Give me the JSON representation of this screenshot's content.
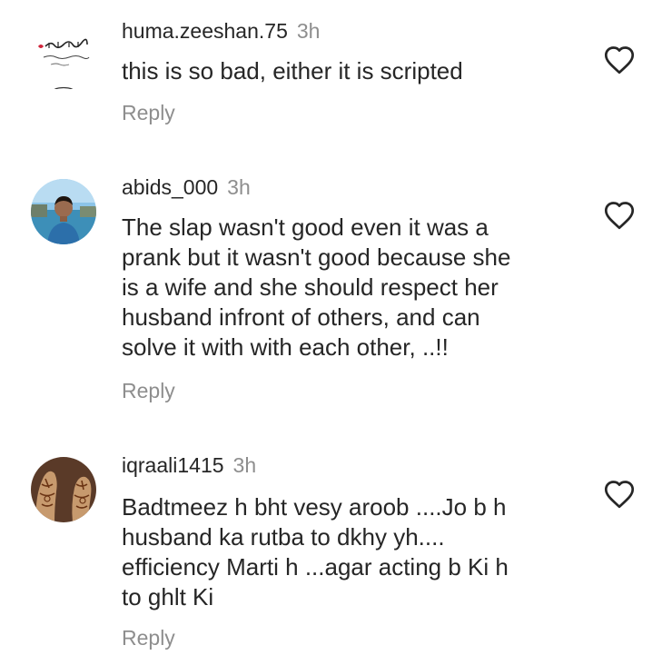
{
  "comments": [
    {
      "username": "huma.zeeshan.75",
      "time": "3h",
      "lines": [
        "this is so bad, either it is scripted"
      ],
      "reply_label": "Reply",
      "avatar_icon": "calligraphy-avatar"
    },
    {
      "username": "abids_000",
      "time": "3h",
      "lines": [
        "The slap wasn't good even it was a",
        "prank but it wasn't good because she",
        "is a wife and she should respect her",
        "husband infront of others, and can",
        "solve it with with each other, ..!!"
      ],
      "reply_label": "Reply",
      "avatar_icon": "person-photo-avatar"
    },
    {
      "username": "iqraali1415",
      "time": "3h",
      "lines": [
        "Badtmeez h bht vesy aroob ....Jo b h",
        "husband ka rutba to dkhy yh....",
        "efficiency Marti h ...agar acting b Ki h",
        "to ghlt Ki"
      ],
      "reply_label": "Reply",
      "avatar_icon": "henna-hands-avatar"
    }
  ],
  "colors": {
    "text": "#262626",
    "secondary": "#8e8e8e",
    "heart_outline": "#262626"
  },
  "icons": {
    "like": "heart-outline-icon"
  }
}
